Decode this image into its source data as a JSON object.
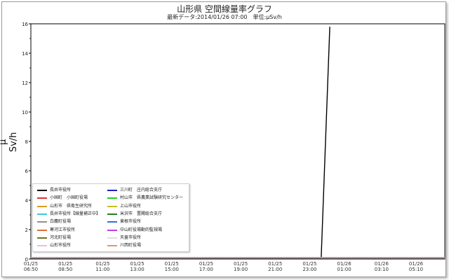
{
  "header": {
    "title": "山形県 空間線量率グラフ",
    "subtitle": "最新データ:2014/01/26 07:00　単位:μSv/h"
  },
  "chart_data": {
    "type": "line",
    "title": "山形県 空間線量率グラフ",
    "subtitle": "最新データ:2014/01/26 07:00　単位:μSv/h",
    "ylabel": "μ Sv/h",
    "xlabel": "",
    "ylim": [
      0,
      16
    ],
    "yticks": [
      "0",
      "2",
      "4",
      "6",
      "8",
      "10",
      "12",
      "14",
      "16"
    ],
    "xlim": [
      "2014-01-25 06:50",
      "2014-01-26 06:50"
    ],
    "xticks": [
      {
        "date": "01/25",
        "time": "06:50"
      },
      {
        "date": "01/25",
        "time": "08:50"
      },
      {
        "date": "01/25",
        "time": "11:00"
      },
      {
        "date": "01/25",
        "time": "13:00"
      },
      {
        "date": "01/25",
        "time": "15:00"
      },
      {
        "date": "01/25",
        "time": "17:00"
      },
      {
        "date": "01/25",
        "time": "19:00"
      },
      {
        "date": "01/25",
        "time": "21:00"
      },
      {
        "date": "01/25",
        "time": "23:00"
      },
      {
        "date": "01/26",
        "time": "01:00"
      },
      {
        "date": "01/26",
        "time": "03:10"
      },
      {
        "date": "01/26",
        "time": "05:10"
      }
    ],
    "grid": true,
    "legend_position": "bottom-left",
    "series": [
      {
        "name": "長井市役所",
        "color": "#000000",
        "points": [
          [
            "2014-01-25 06:50",
            0.05
          ],
          [
            "2014-01-25 23:40",
            0.05
          ],
          [
            "2014-01-26 00:10",
            15.8
          ]
        ]
      },
      {
        "name": "小国町　小国町役場",
        "color": "#e03030"
      },
      {
        "name": "山形市　県衛生研究所",
        "color": "#d8a020"
      },
      {
        "name": "長井市役所【線量補正中】",
        "color": "#40c8e0"
      },
      {
        "name": "白鷹町役場",
        "color": "#909090"
      },
      {
        "name": "寒河江市役所",
        "color": "#e07030"
      },
      {
        "name": "河北町役場",
        "color": "#707020"
      },
      {
        "name": "山形市役所",
        "color": "#f0b8e0"
      },
      {
        "name": "三川町　庄内総合支庁",
        "color": "#2020c0"
      },
      {
        "name": "村山市　県農業試験研究センター",
        "color": "#20d020"
      },
      {
        "name": "上山市役所",
        "color": "#c0c020"
      },
      {
        "name": "米沢市　置賜総合支庁",
        "color": "#208020"
      },
      {
        "name": "東根市役所",
        "color": "#3070e0"
      },
      {
        "name": "中山町役場動的監視場",
        "color": "#c040e0"
      },
      {
        "name": "天童市役所",
        "color": "#e0e0e0"
      },
      {
        "name": "川西町役場",
        "color": "#f09070"
      }
    ]
  }
}
